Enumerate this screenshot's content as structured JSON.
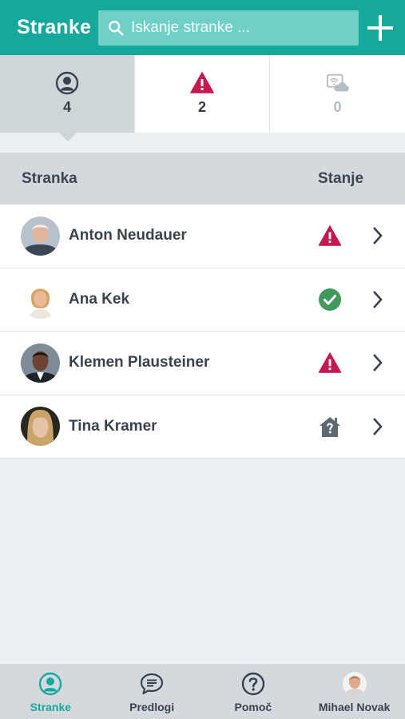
{
  "app": {
    "title": "Stranke"
  },
  "search": {
    "placeholder": "Iskanje stranke ..."
  },
  "filters": [
    {
      "icon": "user-circle-icon",
      "count": "4",
      "active": true
    },
    {
      "icon": "warning-icon",
      "count": "2",
      "active": false
    },
    {
      "icon": "offline-cloud-icon",
      "count": "0",
      "active": false
    }
  ],
  "table": {
    "header": {
      "name": "Stranka",
      "state": "Stanje"
    },
    "rows": [
      {
        "name": "Anton Neudauer",
        "state": "warning-icon"
      },
      {
        "name": "Ana Kek",
        "state": "check-circle-icon"
      },
      {
        "name": "Klemen Plausteiner",
        "state": "warning-icon"
      },
      {
        "name": "Tina Kramer",
        "state": "house-alert-icon"
      }
    ]
  },
  "bottom_nav": [
    {
      "label": "Stranke",
      "icon": "user-circle-icon",
      "active": true
    },
    {
      "label": "Predlogi",
      "icon": "chat-bubble-icon",
      "active": false
    },
    {
      "label": "Pomoč",
      "icon": "help-circle-icon",
      "active": false
    },
    {
      "label": "Mihael Novak",
      "icon": "avatar",
      "active": false
    }
  ],
  "colors": {
    "primary": "#17a89c",
    "warning": "#c8174f",
    "success": "#3f9a5c",
    "neutral": "#5d6870"
  }
}
